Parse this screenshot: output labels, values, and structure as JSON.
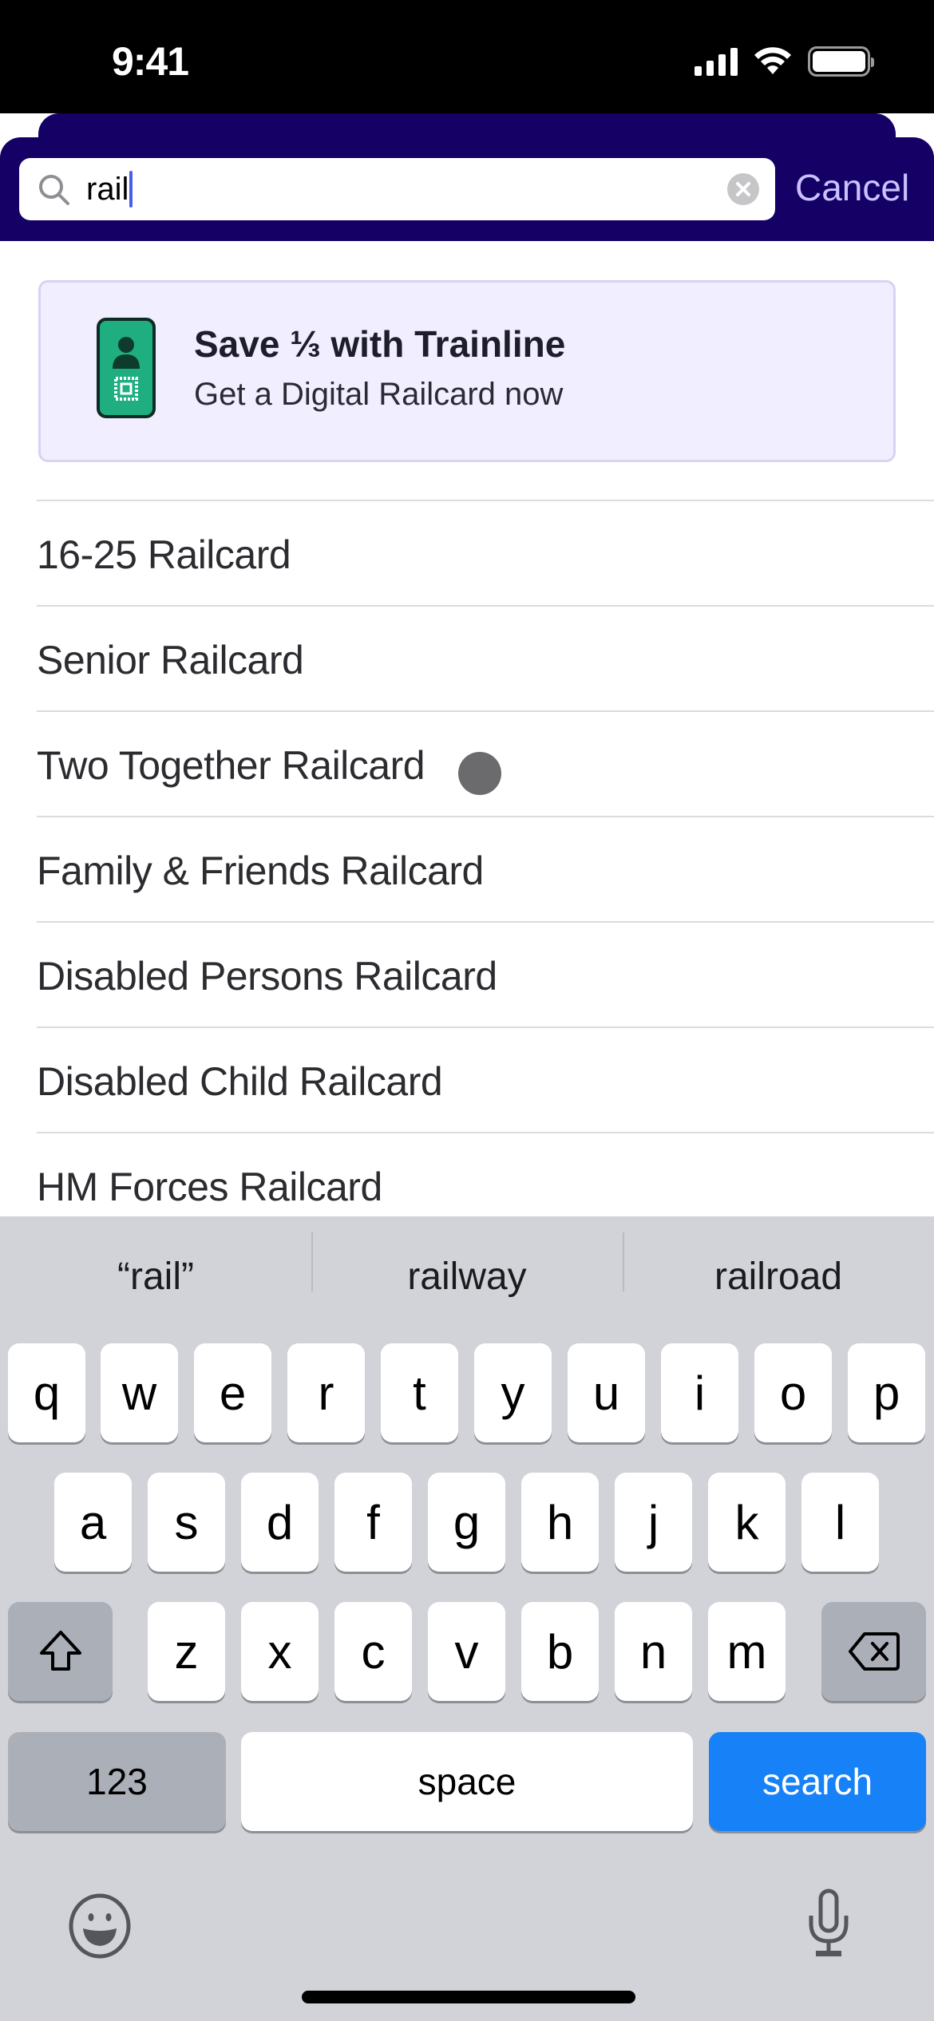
{
  "status_bar": {
    "time": "9:41",
    "icons": [
      "cellular-signal-icon",
      "wifi-icon",
      "battery-icon"
    ]
  },
  "search": {
    "value": "rail",
    "cancel_label": "Cancel",
    "icons": {
      "search": "search-icon",
      "clear": "clear-icon"
    }
  },
  "banner": {
    "title": "Save ⅓ with Trainline",
    "subtitle": "Get a Digital Railcard now",
    "icon": "digital-railcard-icon",
    "colors": {
      "background": "#f1efff",
      "icon_green": "#1fae7f"
    }
  },
  "results": [
    {
      "label": "16-25 Railcard"
    },
    {
      "label": "Senior Railcard"
    },
    {
      "label": "Two Together Railcard"
    },
    {
      "label": "Family & Friends Railcard"
    },
    {
      "label": "Disabled Persons Railcard"
    },
    {
      "label": "Disabled Child Railcard"
    },
    {
      "label": "HM Forces Railcard"
    }
  ],
  "keyboard": {
    "suggestions": [
      "“rail”",
      "railway",
      "railroad"
    ],
    "row1": [
      "q",
      "w",
      "e",
      "r",
      "t",
      "y",
      "u",
      "i",
      "o",
      "p"
    ],
    "row2": [
      "a",
      "s",
      "d",
      "f",
      "g",
      "h",
      "j",
      "k",
      "l"
    ],
    "row3": [
      "z",
      "x",
      "c",
      "v",
      "b",
      "n",
      "m"
    ],
    "numbers_label": "123",
    "space_label": "space",
    "search_label": "search",
    "icons": {
      "shift": "shift-icon",
      "delete": "delete-icon",
      "emoji": "emoji-icon",
      "mic": "microphone-icon"
    }
  },
  "colors": {
    "header": "#150066",
    "cancel": "#c9c2ff",
    "keyboard_bg": "#d1d3d9",
    "search_key": "#1781f8"
  }
}
